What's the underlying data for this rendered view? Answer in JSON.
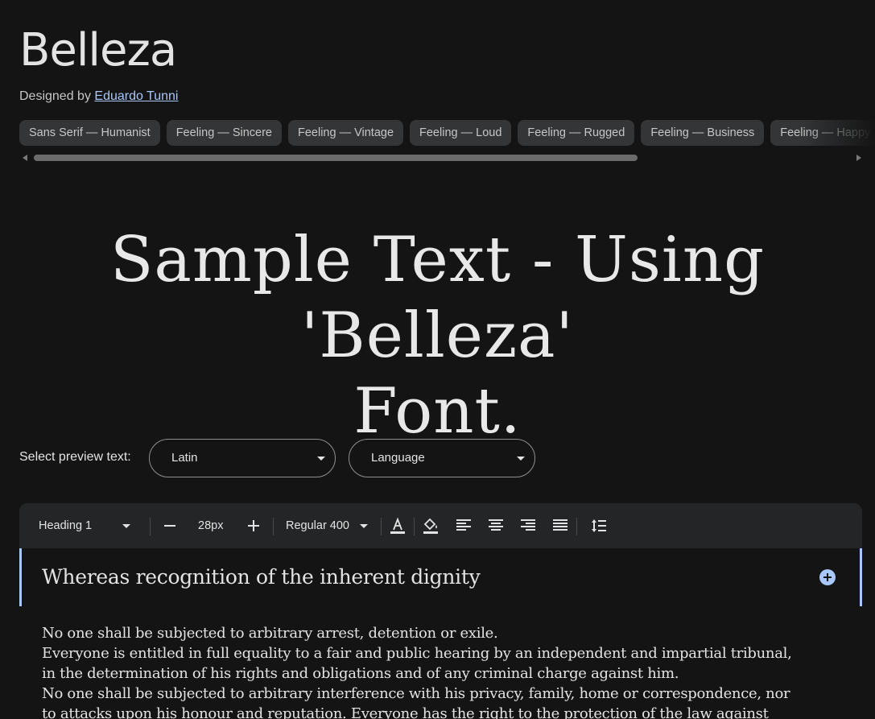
{
  "font": {
    "name": "Belleza",
    "designed_by_prefix": "Designed by",
    "designer": "Eduardo Tunni"
  },
  "tags": [
    "Sans Serif — Humanist",
    "Feeling — Sincere",
    "Feeling — Vintage",
    "Feeling — Loud",
    "Feeling — Rugged",
    "Feeling — Business",
    "Feeling — Happy"
  ],
  "sample_text": {
    "line1": "Sample Text - Using 'Belleza'",
    "line2": "Font."
  },
  "preview": {
    "label": "Select preview text:",
    "script_value": "Latin",
    "language_value": "Language"
  },
  "toolbar": {
    "style": "Heading 1",
    "size": "28px",
    "weight": "Regular 400"
  },
  "editor": {
    "heading": "Whereas recognition of the inherent dignity",
    "paragraph_lines": [
      "No one shall be subjected to arbitrary arrest, detention or exile.",
      "Everyone is entitled in full equality to a fair and public hearing by an independent and impartial tribunal,",
      "in the determination of his rights and obligations and of any criminal charge against him.",
      "No one shall be subjected to arbitrary interference with his privacy, family, home or correspondence, nor",
      "to attacks upon his honour and reputation. Everyone has the right to the protection of the law against"
    ]
  },
  "colors": {
    "background": "#141414",
    "accent": "#a8c7fa",
    "chip": "#333537"
  }
}
